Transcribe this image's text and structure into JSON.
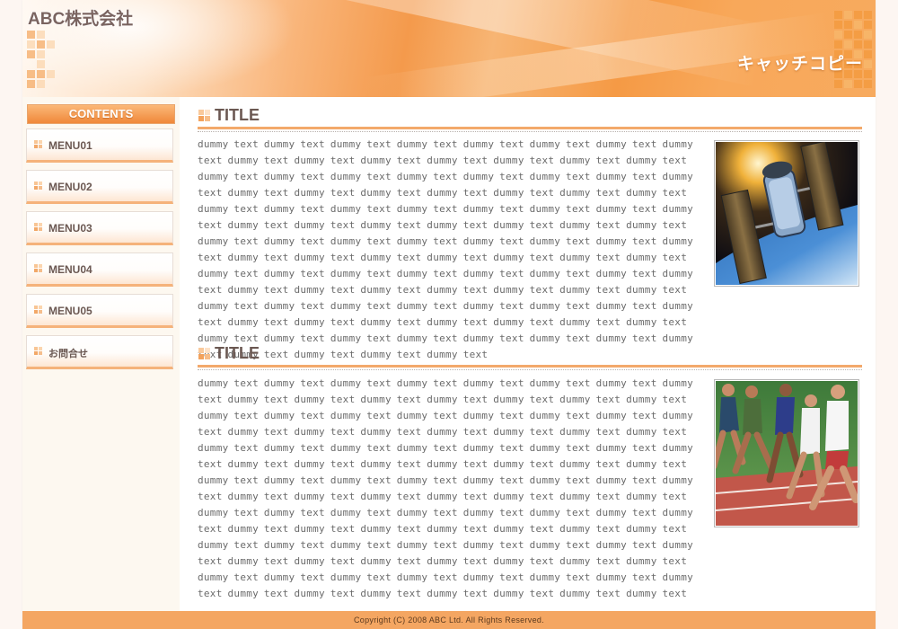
{
  "header": {
    "site_title": "ABC株式会社",
    "catch_copy": "キャッチコピー"
  },
  "sidebar": {
    "heading": "CONTENTS",
    "items": [
      {
        "label": "MENU01"
      },
      {
        "label": "MENU02"
      },
      {
        "label": "MENU03"
      },
      {
        "label": "MENU04"
      },
      {
        "label": "MENU05"
      },
      {
        "label": "お問合せ"
      }
    ]
  },
  "main": {
    "sections": [
      {
        "title": "TITLE",
        "image": "space-station-photo",
        "text": "dummy text dummy text dummy text dummy text dummy text dummy text dummy text dummy text dummy text dummy text dummy text dummy text dummy text dummy text dummy text dummy text dummy text dummy text dummy text dummy text dummy text dummy text dummy text dummy text dummy text dummy text dummy text dummy text dummy text dummy text dummy text dummy text dummy text dummy text dummy text dummy text dummy text dummy text dummy text dummy text dummy text dummy text dummy text dummy text dummy text dummy text dummy text dummy text dummy text dummy text dummy text dummy text dummy text dummy text dummy text dummy text dummy text dummy text dummy text dummy text dummy text dummy text dummy text dummy text dummy text dummy text dummy text dummy text dummy text dummy text dummy text dummy text dummy text dummy text dummy text dummy text dummy text dummy text dummy text dummy text dummy text dummy text dummy text dummy text dummy text dummy text dummy text dummy text dummy text dummy text dummy text dummy text dummy text dummy text dummy text dummy text dummy text dummy text dummy text dummy text dummy text dummy text"
      },
      {
        "title": "TITLE",
        "image": "runners-photo",
        "text": "dummy text dummy text dummy text dummy text dummy text dummy text dummy text dummy text dummy text dummy text dummy text dummy text dummy text dummy text dummy text dummy text dummy text dummy text dummy text dummy text dummy text dummy text dummy text dummy text dummy text dummy text dummy text dummy text dummy text dummy text dummy text dummy text dummy text dummy text dummy text dummy text dummy text dummy text dummy text dummy text dummy text dummy text dummy text dummy text dummy text dummy text dummy text dummy text dummy text dummy text dummy text dummy text dummy text dummy text dummy text dummy text dummy text dummy text dummy text dummy text dummy text dummy text dummy text dummy text dummy text dummy text dummy text dummy text dummy text dummy text dummy text dummy text dummy text dummy text dummy text dummy text dummy text dummy text dummy text dummy text dummy text dummy text dummy text dummy text dummy text dummy text dummy text dummy text dummy text dummy text dummy text dummy text dummy text dummy text dummy text dummy text dummy text dummy text dummy text dummy text dummy text dummy text dummy text dummy text dummy text"
      }
    ]
  },
  "footer": {
    "copyright": "Copyright (C) 2008 ABC Ltd. All Rights Reserved."
  },
  "colors": {
    "accent": "#f3a96b",
    "footer": "#f4a662",
    "sidebar_bg": "#fdf8f0",
    "text": "#6b5852"
  }
}
